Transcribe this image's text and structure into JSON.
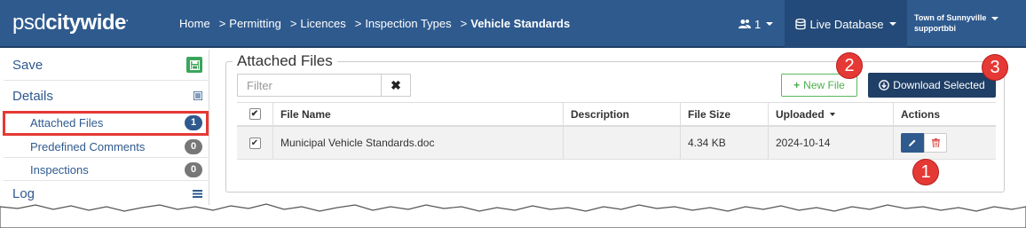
{
  "header": {
    "logo_a": "psd",
    "logo_b": "citywide",
    "logo_mark": ".",
    "breadcrumbs": [
      "Home",
      "Permitting",
      "Licences",
      "Inspection Types"
    ],
    "breadcrumb_current": "Vehicle Standards",
    "breadcrumb_sep": ">",
    "user_count": "1",
    "database_label": "Live Database",
    "town_name": "Town of Sunnyville",
    "username": "supportbbi"
  },
  "sidebar": {
    "save_label": "Save",
    "details_label": "Details",
    "items": [
      {
        "label": "Attached Files",
        "count": "1"
      },
      {
        "label": "Predefined Comments",
        "count": "0"
      },
      {
        "label": "Inspections",
        "count": "0"
      }
    ],
    "log_label": "Log"
  },
  "main": {
    "title": "Attached Files",
    "filter_placeholder": "Filter",
    "new_file_label": "New File",
    "download_label": "Download Selected",
    "columns": [
      "File Name",
      "Description",
      "File Size",
      "Uploaded",
      "Actions"
    ],
    "rows": [
      {
        "file_name": "Municipal Vehicle Standards.doc",
        "description": "",
        "file_size": "4.34 KB",
        "uploaded": "2024-10-14"
      }
    ]
  },
  "callouts": [
    "1",
    "2",
    "3"
  ],
  "colors": {
    "nav": "#2f5a8e",
    "nav_dark": "#234a78",
    "download_button": "#1f3f66",
    "new_file": "#5cb85c",
    "callout": "#e53935"
  }
}
